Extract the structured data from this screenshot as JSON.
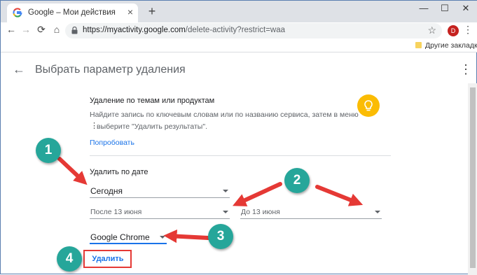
{
  "browser": {
    "tab_title": "Google – Мои действия",
    "tab_close": "×",
    "new_tab": "+",
    "window_controls": {
      "minimize": "—",
      "maximize": "☐",
      "close": "✕"
    },
    "nav": {
      "back": "←",
      "forward": "→",
      "reload": "⟳",
      "home": "⌂"
    },
    "url_host": "https://myactivity.google.com",
    "url_path": "/delete-activity?restrict=waa",
    "star": "☆",
    "avatar_letter": "D",
    "menu": "⋮",
    "bookmark_folder": "Другие закладки"
  },
  "page": {
    "back_arrow": "←",
    "title": "Выбрать параметр удаления",
    "menu": "⋮"
  },
  "topics": {
    "heading": "Удаление по темам или продуктам",
    "hint_line1": "Найдите запись по ключевым словам или по названию сервиса, затем в меню",
    "hint_dots": "⋮",
    "hint_line2": "выберите \"Удалить результаты\".",
    "link": "Попробовать"
  },
  "by_date": {
    "heading": "Удалить по дате",
    "period": "Сегодня",
    "after": "После 13 июня",
    "before": "До 13 июня",
    "product": "Google Chrome",
    "delete_button": "Удалить"
  },
  "annotations": [
    "1",
    "2",
    "3",
    "4"
  ],
  "colors": {
    "accent": "#1a73e8",
    "annotation_badge": "#26a69a",
    "annotation_arrow": "#e53935",
    "bulb": "#fbbc04"
  },
  "icons": {
    "google_favicon": "google-favicon-icon",
    "lock": "lock-icon",
    "bulb": "lightbulb-icon",
    "folder": "folder-icon"
  }
}
